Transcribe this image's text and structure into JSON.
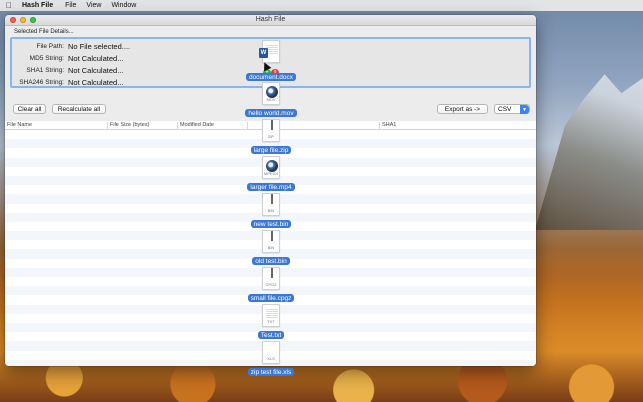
{
  "menubar": {
    "app_name": "Hash File",
    "items": [
      "File",
      "View",
      "Window"
    ]
  },
  "window": {
    "title": "Hash File"
  },
  "details": {
    "group_label": "Selected File Details...",
    "rows": [
      {
        "label": "File Path:",
        "value": "No File selected...."
      },
      {
        "label": "MD5 String:",
        "value": "Not Calculated..."
      },
      {
        "label": "SHA1 String:",
        "value": "Not Calculated..."
      },
      {
        "label": "SHA246 String:",
        "value": "Not Calculated..."
      }
    ]
  },
  "toolbar": {
    "clear_all": "Clear all",
    "recalculate_all": "Recalculate all",
    "export_as": "Export as ->",
    "format_selected": "CSV"
  },
  "table": {
    "columns": [
      "File Name",
      "File Size (bytes)",
      "Modified Date",
      "",
      "SHA1"
    ],
    "rows": []
  },
  "dragged_files": [
    {
      "name": "document.docx",
      "ext": "",
      "icon": "word-document-icon"
    },
    {
      "name": "hello world.mov",
      "ext": "MOV",
      "icon": "quicktime-icon"
    },
    {
      "name": "large file.zip",
      "ext": "ZIP",
      "icon": "zip-archive-icon"
    },
    {
      "name": "larger file.mp4",
      "ext": "MPEG4",
      "icon": "quicktime-icon"
    },
    {
      "name": "new test.bin",
      "ext": "BIN",
      "icon": "zip-archive-icon"
    },
    {
      "name": "old test.bin",
      "ext": "BIN",
      "icon": "zip-archive-icon"
    },
    {
      "name": "small file.cpgz",
      "ext": "CPGZ",
      "icon": "zip-archive-icon"
    },
    {
      "name": "Test.txt",
      "ext": "TXT",
      "icon": "text-document-icon"
    },
    {
      "name": "zip test file.xls",
      "ext": "XLS",
      "icon": "document-icon"
    }
  ],
  "drag_badge_count": "9",
  "colors": {
    "accent": "#3b77d6",
    "selection_border": "#8ab4f0"
  }
}
